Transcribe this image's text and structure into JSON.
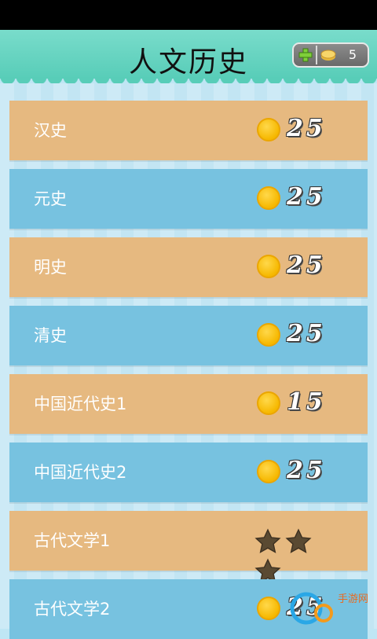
{
  "header": {
    "title": "人文历史",
    "coins": "5"
  },
  "items": [
    {
      "label": "汉史",
      "type": "coin",
      "cost": "25"
    },
    {
      "label": "元史",
      "type": "coin",
      "cost": "25"
    },
    {
      "label": "明史",
      "type": "coin",
      "cost": "25"
    },
    {
      "label": "清史",
      "type": "coin",
      "cost": "25"
    },
    {
      "label": "中国近代史1",
      "type": "coin",
      "cost": "15"
    },
    {
      "label": "中国近代史2",
      "type": "coin",
      "cost": "25"
    },
    {
      "label": "古代文学1",
      "type": "stars",
      "stars": 3
    },
    {
      "label": "古代文学2",
      "type": "coin",
      "cost": "25"
    }
  ],
  "watermark": {
    "text": "手游网"
  },
  "colors": {
    "orange_row": "#e6b980",
    "blue_row": "#77c2e0",
    "header": "#58cdb8"
  }
}
